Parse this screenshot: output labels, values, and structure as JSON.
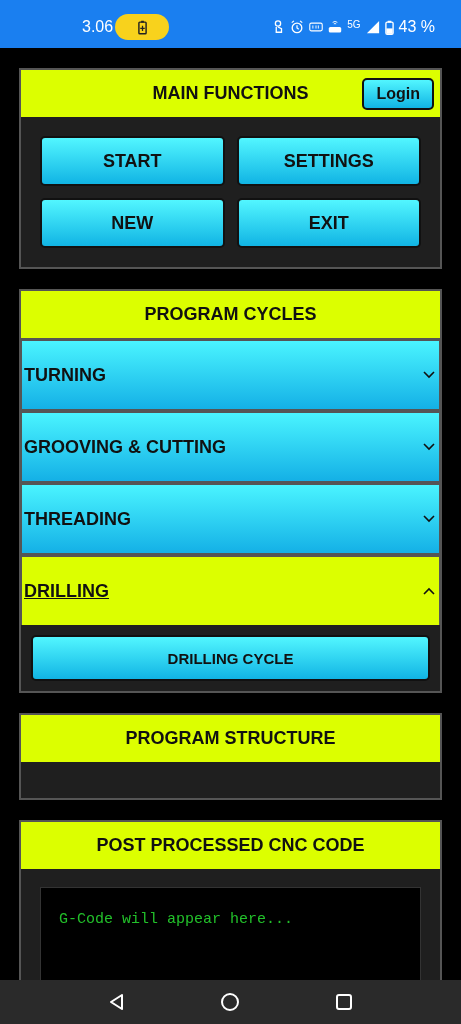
{
  "status_bar": {
    "time": "3.06",
    "charging": true,
    "network": "5G",
    "battery": "43 %"
  },
  "main_functions": {
    "title": "MAIN FUNCTIONS",
    "login": "Login",
    "buttons": [
      "START",
      "SETTINGS",
      "NEW",
      "EXIT"
    ]
  },
  "program_cycles": {
    "title": "PROGRAM CYCLES",
    "sections": [
      {
        "title": "TURNING",
        "expanded": false
      },
      {
        "title": "GROOVING & CUTTING",
        "expanded": false
      },
      {
        "title": "THREADING",
        "expanded": false
      },
      {
        "title": "DRILLING",
        "expanded": true,
        "buttons": [
          "DRILLING CYCLE"
        ]
      }
    ]
  },
  "program_structure": {
    "title": "PROGRAM STRUCTURE"
  },
  "cnc_code": {
    "title": "POST PROCESSED CNC CODE",
    "text": "G-Code will appear here..."
  }
}
